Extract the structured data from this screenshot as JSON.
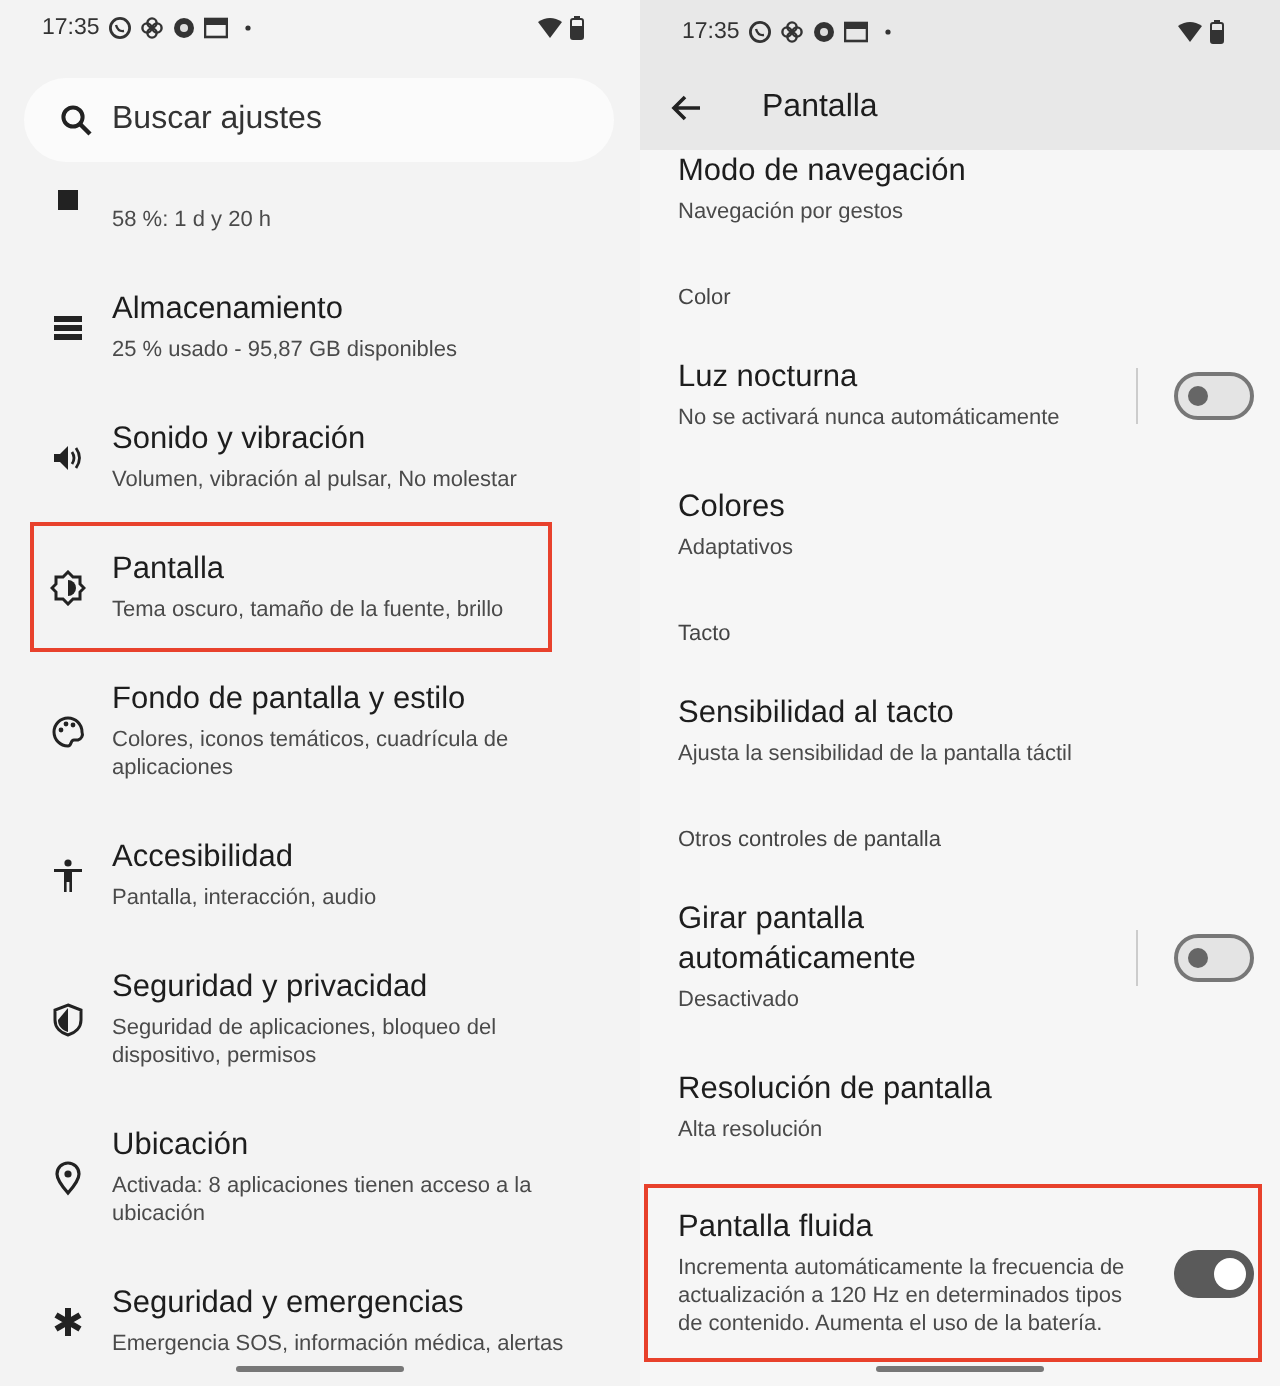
{
  "left_screen": {
    "status_time": "17:35",
    "search": {
      "placeholder": "Buscar ajustes"
    },
    "items": [
      {
        "kind": "cut",
        "subtitle": "58 %: 1 d y 20 h",
        "highlighted": false
      },
      {
        "kind": "item",
        "title": "Almacenamiento",
        "subtitle": "25 % usado - 95,87 GB disponibles",
        "highlighted": false
      },
      {
        "kind": "item",
        "title": "Sonido y vibración",
        "subtitle": "Volumen, vibración al pulsar, No molestar",
        "highlighted": false
      },
      {
        "kind": "item",
        "title": "Pantalla",
        "subtitle": "Tema oscuro, tamaño de la fuente, brillo",
        "highlighted": true
      },
      {
        "kind": "item",
        "title": "Fondo de pantalla y estilo",
        "subtitle": "Colores, iconos temáticos, cuadrícula de aplicaciones",
        "highlighted": false
      },
      {
        "kind": "item",
        "title": "Accesibilidad",
        "subtitle": "Pantalla, interacción, audio",
        "highlighted": false
      },
      {
        "kind": "item",
        "title": "Seguridad y privacidad",
        "subtitle": "Seguridad de aplicaciones, bloqueo del dispositivo, permisos",
        "highlighted": false
      },
      {
        "kind": "item",
        "title": "Ubicación",
        "subtitle": "Activada: 8 aplicaciones tienen acceso a la ubicación",
        "highlighted": false
      },
      {
        "kind": "item",
        "title": "Seguridad y emergencias",
        "subtitle": "Emergencia SOS, información médica, alertas",
        "highlighted": false
      }
    ]
  },
  "right_screen": {
    "status_time": "17:35",
    "title": "Pantalla",
    "rows": [
      {
        "kind": "item",
        "title": "Modo de navegación",
        "subtitle": "Navegación por gestos",
        "highlighted": false
      },
      {
        "kind": "header",
        "title": "Color"
      },
      {
        "kind": "link-toggle",
        "title": "Luz nocturna",
        "subtitle": "No se activará nunca automáticamente",
        "on": false,
        "highlighted": false
      },
      {
        "kind": "item",
        "title": "Colores",
        "subtitle": "Adaptativos",
        "highlighted": false
      },
      {
        "kind": "header",
        "title": "Tacto"
      },
      {
        "kind": "item",
        "title": "Sensibilidad al tacto",
        "subtitle": "Ajusta la sensibilidad de la pantalla táctil",
        "highlighted": false
      },
      {
        "kind": "header",
        "title": "Otros controles de pantalla"
      },
      {
        "kind": "link-toggle",
        "title": "Girar pantalla automáticamente",
        "subtitle": "Desactivado",
        "on": false,
        "highlighted": false
      },
      {
        "kind": "item",
        "title": "Resolución de pantalla",
        "subtitle": "Alta resolución",
        "highlighted": false
      },
      {
        "kind": "toggle",
        "title": "Pantalla fluida",
        "subtitle": "Incrementa automáticamente la frecuencia de actualización a 120 Hz en determinados tipos de contenido. Aumenta el uso de la batería.",
        "on": true,
        "highlighted": true
      }
    ]
  }
}
